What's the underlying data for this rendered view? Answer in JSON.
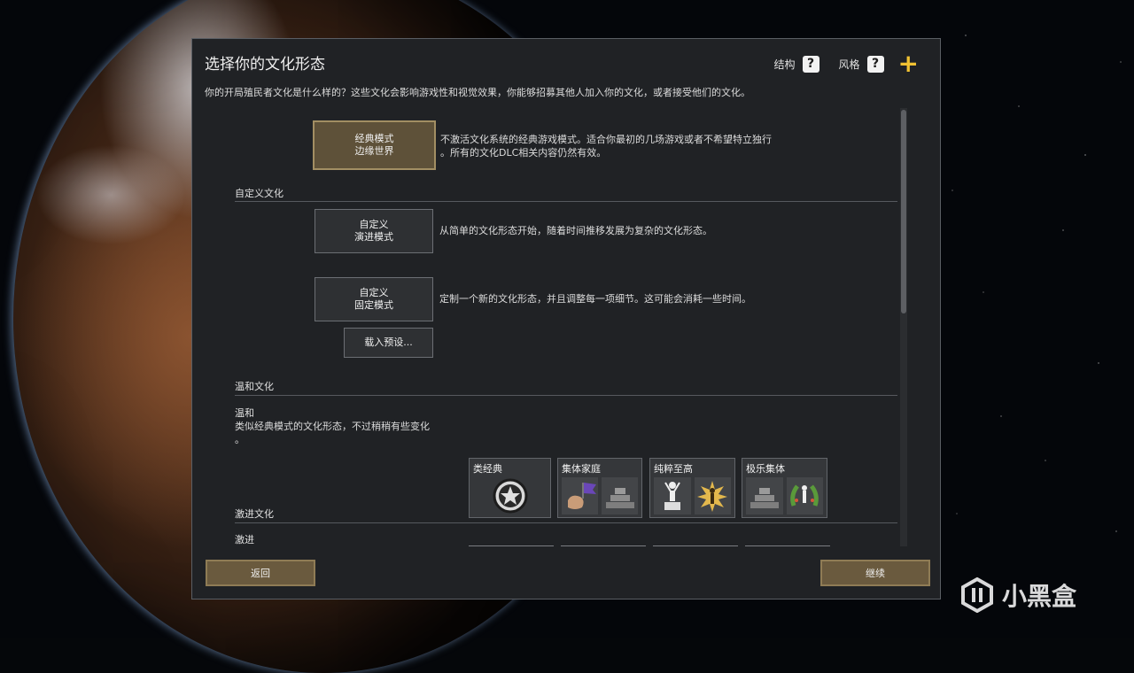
{
  "dialog": {
    "title": "选择你的文化形态",
    "structure_label": "结构",
    "style_label": "风格",
    "intro": "你的开局殖民者文化是什么样的？这些文化会影响游戏性和视觉效果，你能够招募其他人加入你的文化，或者接受他们的文化。"
  },
  "classic": {
    "button": "经典模式\n边缘世界",
    "description": "不激活文化系统的经典游戏模式。适合你最初的几场游戏或者不希望特立独行\n。所有的文化DLC相关内容仍然有效。"
  },
  "custom_section": {
    "heading": "自定义文化",
    "evolving_button": "自定义\n演进模式",
    "evolving_desc": "从简单的文化形态开始，随着时间推移发展为复杂的文化形态。",
    "fixed_button": "自定义\n固定模式",
    "fixed_desc": "定制一个新的文化形态，并且调整每一项细节。这可能会消耗一些时间。",
    "load_preset": "载入预设..."
  },
  "mild_section": {
    "heading": "温和文化",
    "preset_name": "温和",
    "preset_desc": "类似经典模式的文化形态，不过稍稍有些变化\n。",
    "cards": [
      {
        "label": "类经典",
        "icons": [
          "star-circle-icon"
        ]
      },
      {
        "label": "集体家庭",
        "icons": [
          "purple-flag-fist-icon",
          "stone-pyramid-icon"
        ]
      },
      {
        "label": "纯粹至高",
        "icons": [
          "figure-on-pedestal-icon",
          "radiant-figure-icon"
        ]
      },
      {
        "label": "极乐集体",
        "icons": [
          "stone-pyramid-icon",
          "laurel-figure-icon"
        ]
      }
    ]
  },
  "radical_section": {
    "heading": "激进文化",
    "preset_name": "激进"
  },
  "footer": {
    "back": "返回",
    "continue": "继续"
  },
  "watermark": "小黑盒",
  "colors": {
    "dialog_bg": "#202225",
    "selected_btn": "#5e5139",
    "footer_btn": "#6a5a3e",
    "accent_plus": "#f1c232"
  }
}
